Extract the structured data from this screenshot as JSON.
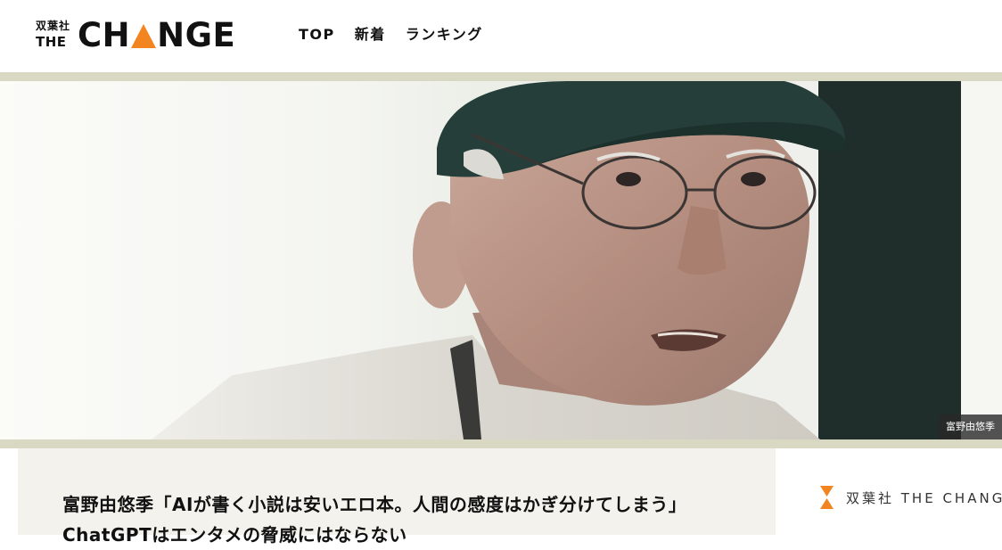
{
  "brand": {
    "publisher": "双葉社",
    "the": "THE",
    "change_pre": "CH",
    "change_post": "NGE",
    "accent_color": "#f2851f",
    "band_color": "#d9d8c3"
  },
  "nav": {
    "items": [
      {
        "label": "TOP"
      },
      {
        "label": "新着"
      },
      {
        "label": "ランキング"
      }
    ]
  },
  "hero": {
    "caption": "富野由悠季"
  },
  "article": {
    "title_line1": "富野由悠季「AIが書く小説は安いエロ本。人間の感度はかぎ分けてしまう」",
    "title_line2": "ChatGPTはエンタメの脅威にはならない"
  },
  "sidebar": {
    "brand_text": "双葉社 THE CHANGE",
    "icon": "hourglass-icon"
  }
}
